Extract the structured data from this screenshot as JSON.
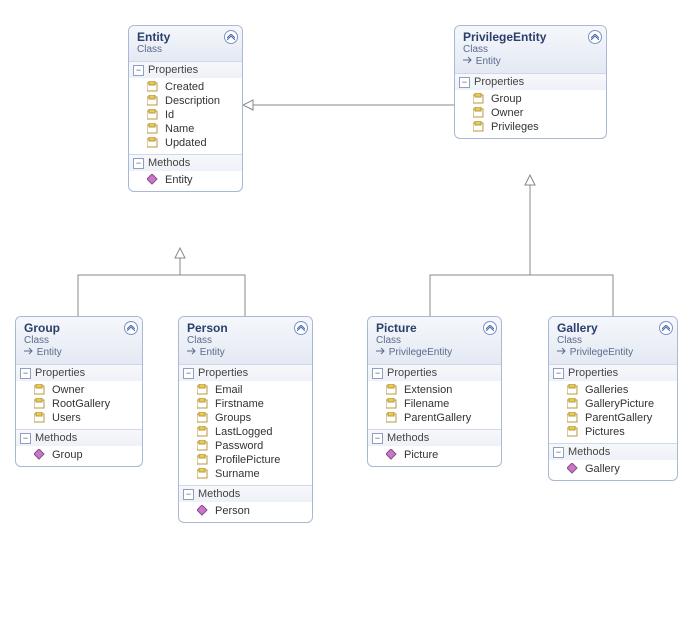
{
  "chart_data": {
    "type": "class-diagram",
    "classes": [
      {
        "name": "Entity",
        "stereotype": "Class",
        "inherits": null,
        "properties": [
          "Created",
          "Description",
          "Id",
          "Name",
          "Updated"
        ],
        "methods": [
          "Entity"
        ]
      },
      {
        "name": "PrivilegeEntity",
        "stereotype": "Class",
        "inherits": "Entity",
        "properties": [
          "Group",
          "Owner",
          "Privileges"
        ],
        "methods": []
      },
      {
        "name": "Group",
        "stereotype": "Class",
        "inherits": "Entity",
        "properties": [
          "Owner",
          "RootGallery",
          "Users"
        ],
        "methods": [
          "Group"
        ]
      },
      {
        "name": "Person",
        "stereotype": "Class",
        "inherits": "Entity",
        "properties": [
          "Email",
          "Firstname",
          "Groups",
          "LastLogged",
          "Password",
          "ProfilePicture",
          "Surname"
        ],
        "methods": [
          "Person"
        ]
      },
      {
        "name": "Picture",
        "stereotype": "Class",
        "inherits": "PrivilegeEntity",
        "properties": [
          "Extension",
          "Filename",
          "ParentGallery"
        ],
        "methods": [
          "Picture"
        ]
      },
      {
        "name": "Gallery",
        "stereotype": "Class",
        "inherits": "PrivilegeEntity",
        "properties": [
          "Galleries",
          "GalleryPicture",
          "ParentGallery",
          "Pictures"
        ],
        "methods": [
          "Gallery"
        ]
      }
    ],
    "inheritance": [
      {
        "from": "PrivilegeEntity",
        "to": "Entity"
      },
      {
        "from": "Group",
        "to": "Entity"
      },
      {
        "from": "Person",
        "to": "Entity"
      },
      {
        "from": "Picture",
        "to": "PrivilegeEntity"
      },
      {
        "from": "Gallery",
        "to": "PrivilegeEntity"
      }
    ]
  },
  "labels": {
    "properties": "Properties",
    "methods": "Methods"
  },
  "entity": {
    "title": "Entity",
    "sub": "Class",
    "props": {
      "p0": "Created",
      "p1": "Description",
      "p2": "Id",
      "p3": "Name",
      "p4": "Updated"
    },
    "methods": {
      "m0": "Entity"
    }
  },
  "priv": {
    "title": "PrivilegeEntity",
    "sub": "Class",
    "inh": "Entity",
    "props": {
      "p0": "Group",
      "p1": "Owner",
      "p2": "Privileges"
    }
  },
  "group": {
    "title": "Group",
    "sub": "Class",
    "inh": "Entity",
    "props": {
      "p0": "Owner",
      "p1": "RootGallery",
      "p2": "Users"
    },
    "methods": {
      "m0": "Group"
    }
  },
  "person": {
    "title": "Person",
    "sub": "Class",
    "inh": "Entity",
    "props": {
      "p0": "Email",
      "p1": "Firstname",
      "p2": "Groups",
      "p3": "LastLogged",
      "p4": "Password",
      "p5": "ProfilePicture",
      "p6": "Surname"
    },
    "methods": {
      "m0": "Person"
    }
  },
  "picture": {
    "title": "Picture",
    "sub": "Class",
    "inh": "PrivilegeEntity",
    "props": {
      "p0": "Extension",
      "p1": "Filename",
      "p2": "ParentGallery"
    },
    "methods": {
      "m0": "Picture"
    }
  },
  "gallery": {
    "title": "Gallery",
    "sub": "Class",
    "inh": "PrivilegeEntity",
    "props": {
      "p0": "Galleries",
      "p1": "GalleryPicture",
      "p2": "ParentGallery",
      "p3": "Pictures"
    },
    "methods": {
      "m0": "Gallery"
    }
  }
}
